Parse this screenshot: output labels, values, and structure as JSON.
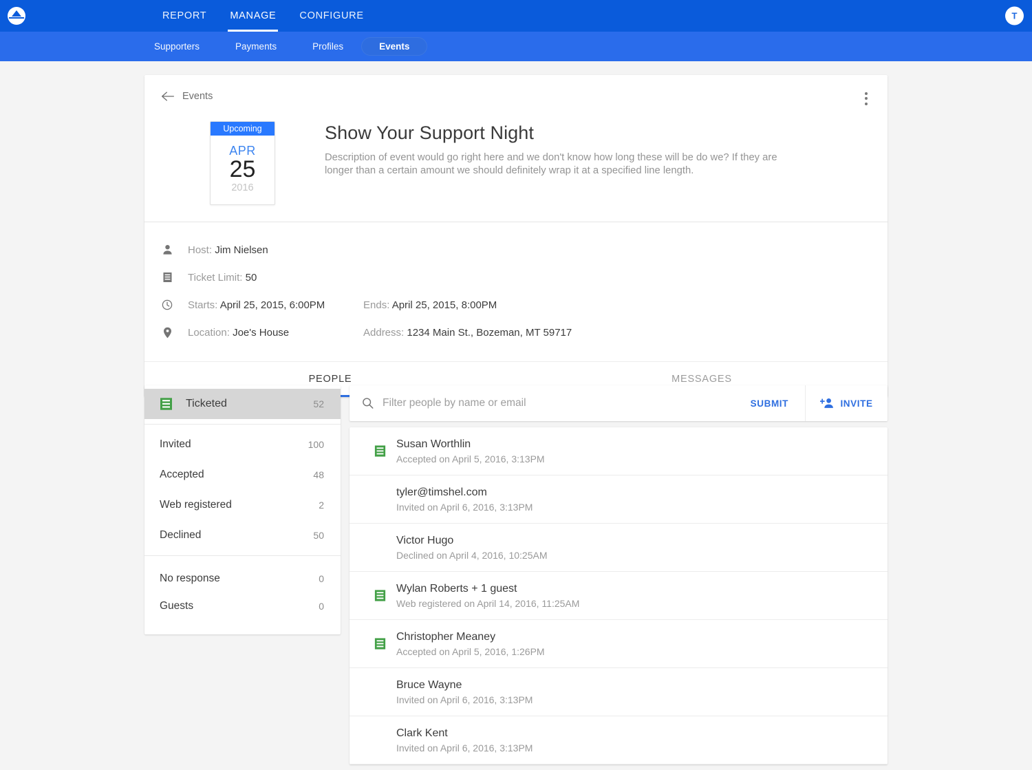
{
  "brand": {
    "logo_icon": "mountain-circle-logo",
    "primary_blue": "#0a5bdb",
    "secondary_blue": "#2a6ceb",
    "accent_blue": "#2f6fe0",
    "ticket_green": "#43a047"
  },
  "topnav": {
    "avatar_initial": "T",
    "items": [
      {
        "label": "REPORT",
        "active": false
      },
      {
        "label": "MANAGE",
        "active": true
      },
      {
        "label": "CONFIGURE",
        "active": false
      }
    ]
  },
  "subnav": {
    "items": [
      {
        "label": "Supporters",
        "active": false
      },
      {
        "label": "Payments",
        "active": false
      },
      {
        "label": "Profiles",
        "active": false
      },
      {
        "label": "Events",
        "active": true
      }
    ]
  },
  "event": {
    "back_label": "Events",
    "badge": "Upcoming",
    "month": "APR",
    "day": "25",
    "year": "2016",
    "title": "Show Your Support Night",
    "description": "Description of event would go right here and we don't know how long these will be do we? If they are longer than a certain amount we should definitely wrap it at a specified line length.",
    "details": [
      {
        "icon": "person-icon",
        "label_a": "Host:",
        "value_a": "Jim Nielsen",
        "label_b": "",
        "value_b": ""
      },
      {
        "icon": "ticket-icon",
        "label_a": "Ticket Limit:",
        "value_a": "50",
        "label_b": "",
        "value_b": ""
      },
      {
        "icon": "clock-icon",
        "label_a": "Starts:",
        "value_a": "April 25, 2015, 6:00PM",
        "label_b": "Ends:",
        "value_b": "April 25, 2015, 8:00PM"
      },
      {
        "icon": "location-pin-icon",
        "label_a": "Location:",
        "value_a": "Joe's House",
        "label_b": "Address:",
        "value_b": "1234 Main St., Bozeman, MT 59717"
      }
    ],
    "tabs": [
      {
        "label": "PEOPLE",
        "active": true
      },
      {
        "label": "MESSAGES",
        "active": false
      }
    ]
  },
  "sidebar": {
    "groups": [
      {
        "items": [
          {
            "label": "Ticketed",
            "count": "52",
            "selected": true,
            "icon": "ticket-icon"
          }
        ]
      },
      {
        "items": [
          {
            "label": "Invited",
            "count": "100",
            "selected": false,
            "icon": ""
          },
          {
            "label": "Accepted",
            "count": "48",
            "selected": false,
            "icon": ""
          },
          {
            "label": "Web registered",
            "count": "2",
            "selected": false,
            "icon": ""
          },
          {
            "label": "Declined",
            "count": "50",
            "selected": false,
            "icon": ""
          }
        ]
      },
      {
        "items": [
          {
            "label": "No response",
            "count": "0",
            "selected": false,
            "icon": ""
          },
          {
            "label": "Guests",
            "count": "0",
            "selected": false,
            "icon": ""
          }
        ]
      }
    ]
  },
  "search": {
    "placeholder": "Filter people by name or email",
    "value": "",
    "submit_label": "SUBMIT",
    "invite_label": "INVITE",
    "search_icon": "search-icon",
    "invite_icon": "person-add-icon"
  },
  "people": [
    {
      "name": "Susan Worthlin",
      "status": "Accepted on April 5, 2016, 3:13PM",
      "ticketed": true
    },
    {
      "name": "tyler@timshel.com",
      "status": "Invited on April 6, 2016, 3:13PM",
      "ticketed": false
    },
    {
      "name": "Victor Hugo",
      "status": "Declined on April 4, 2016, 10:25AM",
      "ticketed": false
    },
    {
      "name": "Wylan Roberts + 1 guest",
      "status": "Web registered on April 14, 2016, 11:25AM",
      "ticketed": true
    },
    {
      "name": "Christopher Meaney",
      "status": "Accepted on April 5, 2016, 1:26PM",
      "ticketed": true
    },
    {
      "name": "Bruce Wayne",
      "status": "Invited on April 6, 2016, 3:13PM",
      "ticketed": false
    },
    {
      "name": "Clark Kent",
      "status": "Invited on April 6, 2016, 3:13PM",
      "ticketed": false
    }
  ]
}
